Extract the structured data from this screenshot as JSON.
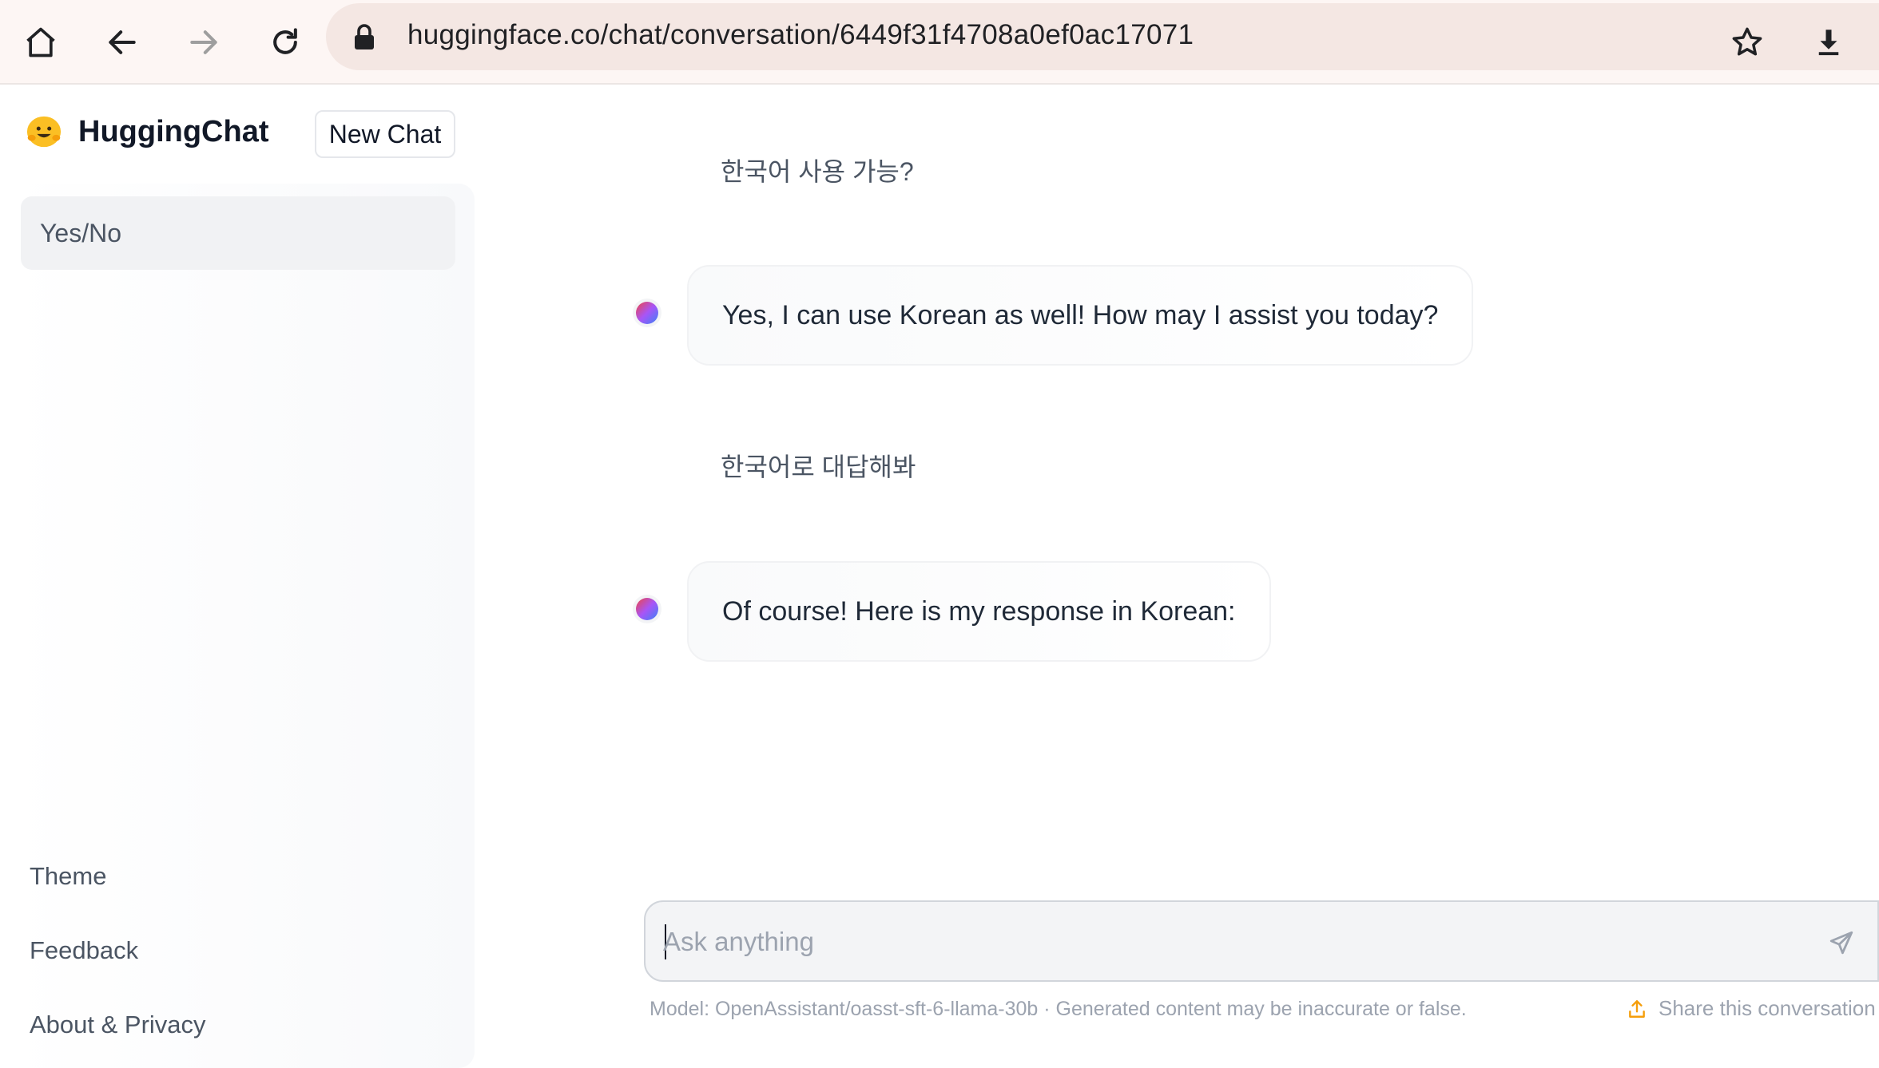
{
  "browser": {
    "url": "huggingface.co/chat/conversation/6449f31f4708a0ef0ac17071"
  },
  "sidebar": {
    "brand": "HuggingChat",
    "new_chat_label": "New Chat",
    "conversations": [
      {
        "title": "Yes/No"
      }
    ],
    "footer": {
      "theme": "Theme",
      "feedback": "Feedback",
      "about": "About & Privacy"
    }
  },
  "chat": {
    "messages": [
      {
        "role": "user",
        "text": "한국어 사용 가능?"
      },
      {
        "role": "assistant",
        "text": "Yes, I can use Korean as well! How may I assist you today?"
      },
      {
        "role": "user",
        "text": "한국어로 대답해봐"
      },
      {
        "role": "assistant",
        "text": "Of course! Here is my response in Korean:"
      }
    ],
    "input": {
      "placeholder": "Ask anything",
      "value": ""
    },
    "model_note": "Model: OpenAssistant/oasst-sft-6-llama-30b · Generated content may be inaccurate or false.",
    "share_label": "Share this conversation"
  },
  "colors": {
    "toolbar_bg": "#fdf6f4",
    "url_bg": "#f4e7e3",
    "brand_yellow": "#fbbf24",
    "share_icon": "#f59e0b"
  }
}
